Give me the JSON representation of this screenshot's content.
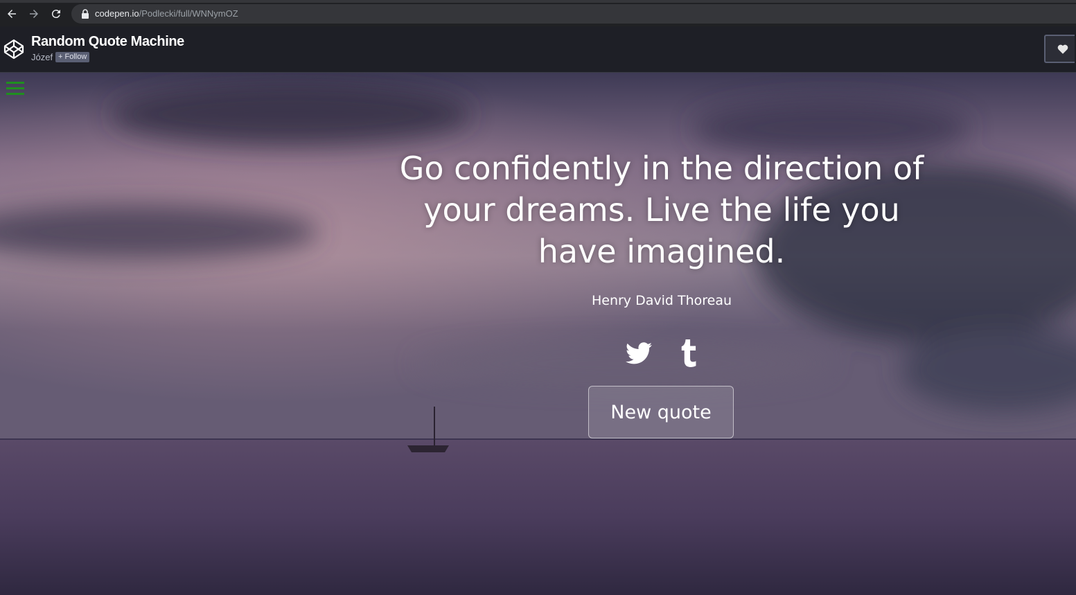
{
  "browser": {
    "url_host": "codepen.io",
    "url_path": "/Podlecki/full/WNNymOZ",
    "icons": {
      "back": "arrow-left-icon",
      "forward": "arrow-right-icon",
      "reload": "reload-icon",
      "lock": "lock-icon"
    }
  },
  "codepen": {
    "title": "Random Quote Machine",
    "author": "Józef",
    "follow_label": "+ Follow",
    "icons": {
      "logo": "codepen-logo-icon",
      "heart": "heart-icon"
    }
  },
  "app": {
    "quote": "Go confidently in the direction of your dreams. Live the life you have imagined.",
    "author": "Henry David Thoreau",
    "new_quote_label": "New quote",
    "icons": {
      "menu": "hamburger-menu-icon",
      "twitter": "twitter-icon",
      "tumblr": "tumblr-icon"
    },
    "colors": {
      "menu": "#1f8f1f",
      "text": "#ffffff"
    }
  }
}
